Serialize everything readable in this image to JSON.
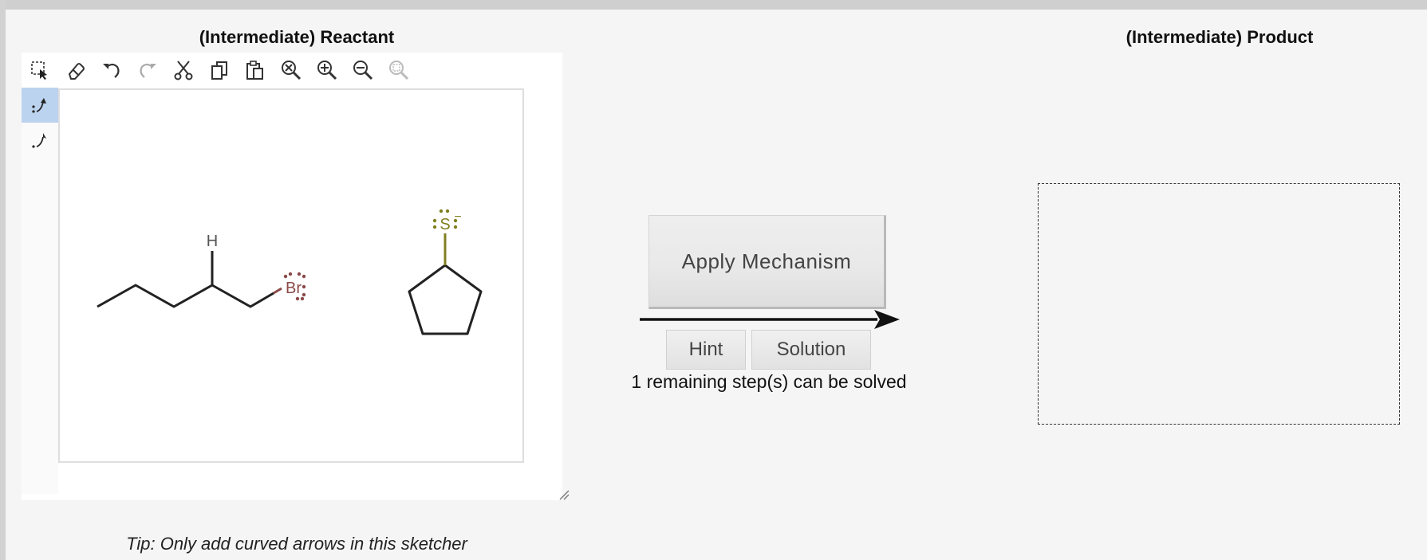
{
  "reactant": {
    "title": "(Intermediate) Reactant"
  },
  "product": {
    "title": "(Intermediate) Product"
  },
  "toolbar": {
    "tools": [
      {
        "icon": "select-icon"
      },
      {
        "icon": "eraser-icon"
      },
      {
        "icon": "undo-icon"
      },
      {
        "icon": "redo-icon"
      },
      {
        "icon": "cut-icon"
      },
      {
        "icon": "copy-icon"
      },
      {
        "icon": "paste-icon"
      },
      {
        "icon": "zoom-reset-icon"
      },
      {
        "icon": "zoom-in-icon"
      },
      {
        "icon": "zoom-out-icon"
      },
      {
        "icon": "zoom-fit-icon"
      }
    ]
  },
  "side_tools": [
    {
      "icon": "electron-pair-arrow-icon",
      "active": true
    },
    {
      "icon": "single-electron-arrow-icon",
      "active": false
    }
  ],
  "molecules": {
    "h_label": "H",
    "br_label": "Br",
    "s_label": "S",
    "s_charge": "−"
  },
  "colors": {
    "bromine": "#8b4a4a",
    "sulfur": "#808020",
    "active_tool": "#bcd3ef"
  },
  "actions": {
    "apply_label": "Apply Mechanism",
    "hint_label": "Hint",
    "solution_label": "Solution",
    "remaining_text": "1 remaining step(s) can be solved"
  },
  "tip": "Tip: Only add curved arrows in this sketcher"
}
